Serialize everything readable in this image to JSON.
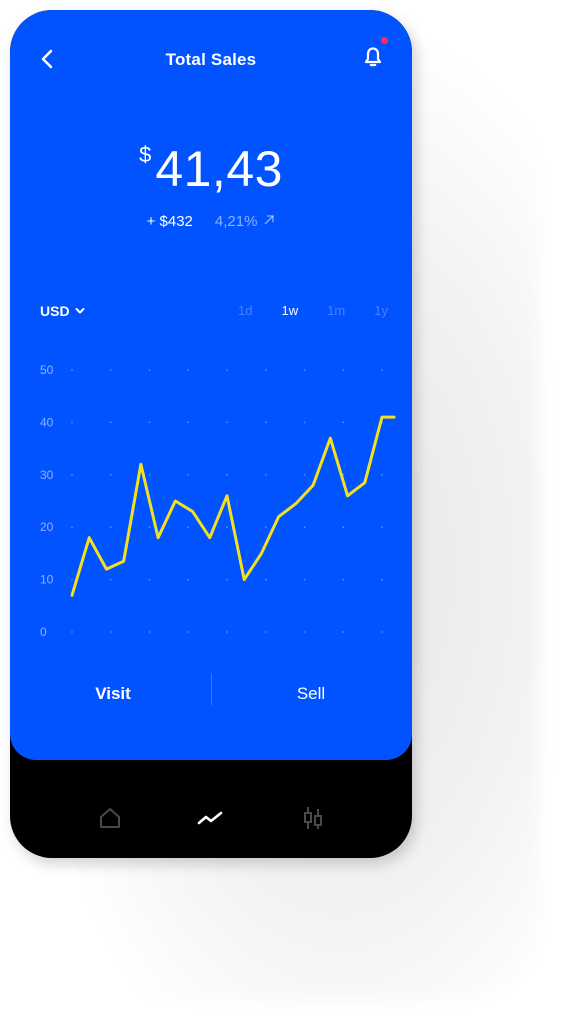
{
  "header": {
    "title": "Total Sales"
  },
  "summary": {
    "currency_symbol": "$",
    "amount": "41,43",
    "change_abs": "+ $432",
    "change_pct": "4,21%"
  },
  "controls": {
    "currency": "USD",
    "periods": [
      "1d",
      "1w",
      "1m",
      "1y"
    ],
    "active_period": "1w"
  },
  "actions": {
    "visit_label": "Visit",
    "sell_label": "Sell"
  },
  "tabbar": {
    "items": [
      "home-icon",
      "chart-trend-icon",
      "candlestick-icon"
    ],
    "active": "chart-trend-icon"
  },
  "colors": {
    "background": "#0152FF",
    "line": "#F2E021",
    "bottom_bar": "#000000",
    "notification_dot": "#FF2D55"
  },
  "chart_data": {
    "type": "line",
    "y_ticks": [
      0,
      10,
      20,
      30,
      40,
      50
    ],
    "ylim": [
      0,
      50
    ],
    "x": [
      0,
      1,
      2,
      3,
      4,
      5,
      6,
      7,
      8,
      9,
      10,
      11,
      12,
      13,
      14,
      15,
      16,
      17,
      18,
      19
    ],
    "series": [
      {
        "values": [
          7,
          18,
          12,
          13.5,
          32,
          18,
          25,
          23,
          18,
          26,
          10,
          15,
          22,
          24.5,
          28,
          37,
          26,
          28.5,
          41,
          41
        ]
      }
    ],
    "grid": "dotted"
  }
}
